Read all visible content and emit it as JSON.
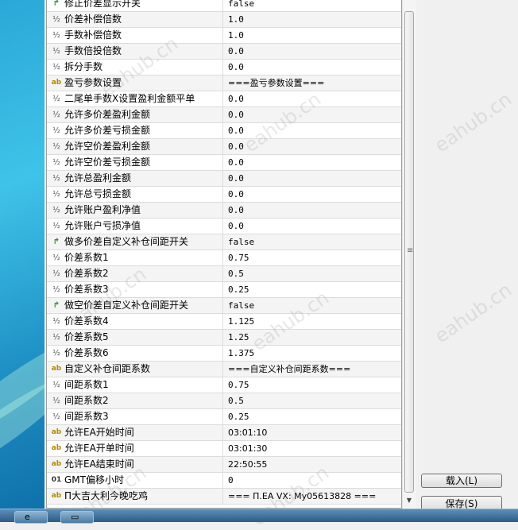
{
  "params": [
    {
      "icon": "bool",
      "name": "修正价差显示开关",
      "value": "false"
    },
    {
      "icon": "frac",
      "name": "价差补偿倍数",
      "value": "1.0"
    },
    {
      "icon": "frac",
      "name": "手数补偿倍数",
      "value": "1.0"
    },
    {
      "icon": "frac",
      "name": "手数倍投倍数",
      "value": "0.0"
    },
    {
      "icon": "frac",
      "name": "拆分手数",
      "value": "0.0"
    },
    {
      "icon": "ab",
      "name": "盈亏参数设置",
      "value": "===盈亏参数设置==="
    },
    {
      "icon": "frac",
      "name": "二尾单手数X设置盈利金额平单",
      "value": "0.0"
    },
    {
      "icon": "frac",
      "name": "允许多价差盈利金额",
      "value": "0.0"
    },
    {
      "icon": "frac",
      "name": "允许多价差亏损金额",
      "value": "0.0"
    },
    {
      "icon": "frac",
      "name": "允许空价差盈利金额",
      "value": "0.0"
    },
    {
      "icon": "frac",
      "name": "允许空价差亏损金额",
      "value": "0.0"
    },
    {
      "icon": "frac",
      "name": "允许总盈利金额",
      "value": "0.0"
    },
    {
      "icon": "frac",
      "name": "允许总亏损金额",
      "value": "0.0"
    },
    {
      "icon": "frac",
      "name": "允许账户盈利净值",
      "value": "0.0"
    },
    {
      "icon": "frac",
      "name": "允许账户亏损净值",
      "value": "0.0"
    },
    {
      "icon": "bool",
      "name": "做多价差自定义补仓间距开关",
      "value": "false"
    },
    {
      "icon": "frac",
      "name": "价差系数1",
      "value": "0.75"
    },
    {
      "icon": "frac",
      "name": "价差系数2",
      "value": "0.5"
    },
    {
      "icon": "frac",
      "name": "价差系数3",
      "value": "0.25"
    },
    {
      "icon": "bool",
      "name": "做空价差自定义补仓间距开关",
      "value": "false"
    },
    {
      "icon": "frac",
      "name": "价差系数4",
      "value": "1.125"
    },
    {
      "icon": "frac",
      "name": "价差系数5",
      "value": "1.25"
    },
    {
      "icon": "frac",
      "name": "价差系数6",
      "value": "1.375"
    },
    {
      "icon": "ab",
      "name": "自定义补仓间距系数",
      "value": "===自定义补仓间距系数==="
    },
    {
      "icon": "frac",
      "name": "间距系数1",
      "value": "0.75"
    },
    {
      "icon": "frac",
      "name": "间距系数2",
      "value": "0.5"
    },
    {
      "icon": "frac",
      "name": "间距系数3",
      "value": "0.25"
    },
    {
      "icon": "ab",
      "name": "允许EA开始时间",
      "value": "03:01:10"
    },
    {
      "icon": "ab",
      "name": "允许EA开单时间",
      "value": "03:01:30"
    },
    {
      "icon": "ab",
      "name": "允许EA结束时间",
      "value": "22:50:55"
    },
    {
      "icon": "int",
      "name": "GMT偏移小时",
      "value": "0"
    },
    {
      "icon": "ab",
      "name": "Π大吉大利今晚吃鸡",
      "value": "=== Π.EA VX: My05613828 ==="
    }
  ],
  "icons": {
    "bool": {
      "glyph": "↱",
      "semantic": "bool-flag-icon"
    },
    "frac": {
      "glyph": "½",
      "semantic": "double-type-icon"
    },
    "ab": {
      "glyph": "ab",
      "semantic": "string-type-icon"
    },
    "int": {
      "glyph": "01",
      "semantic": "integer-type-icon"
    }
  },
  "buttons": {
    "load": "载入(L)",
    "save": "保存(S)"
  },
  "watermark": "eahub.cn",
  "colors": {
    "grid_border": "#a0a0a0",
    "alt_row": "#f4f4f4",
    "bool_icon": "#2f8f2f",
    "string_icon": "#b08a00"
  }
}
